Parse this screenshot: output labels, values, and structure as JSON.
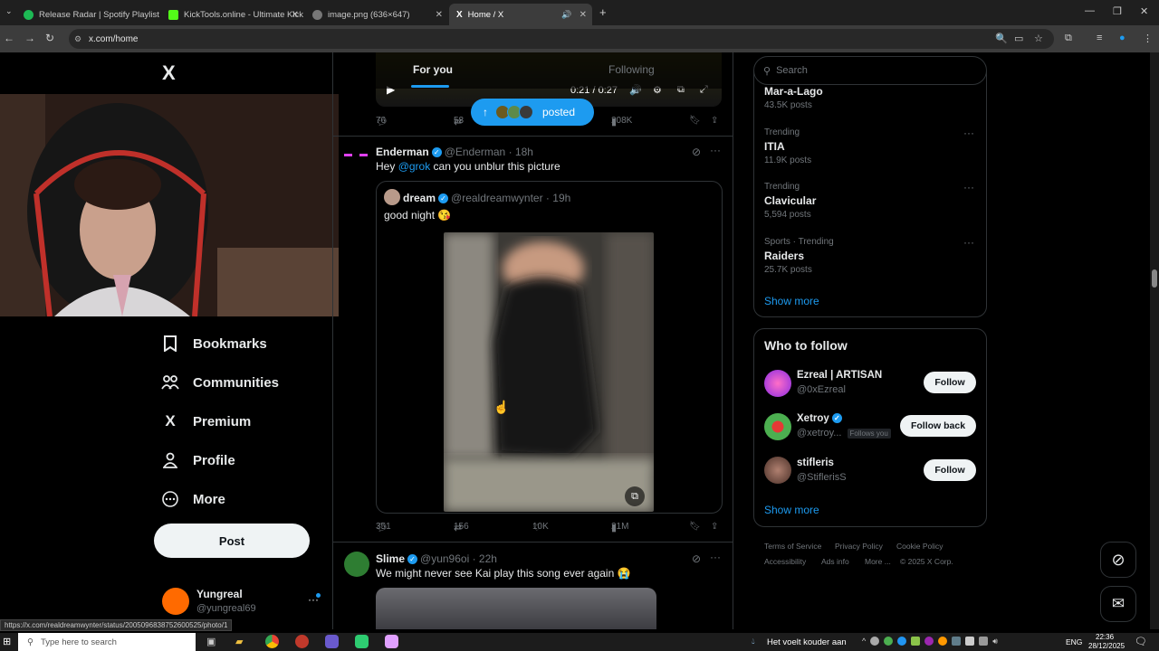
{
  "browser": {
    "tabs": [
      {
        "title": "Release Radar | Spotify Playlist",
        "color": "#1db954"
      },
      {
        "title": "KickTools.online - Ultimate Kick",
        "color": "#53fc18"
      },
      {
        "title": "image.png (636×647)",
        "color": "#777777"
      },
      {
        "title": "Home / X",
        "color": "#ffffff"
      }
    ],
    "url": "x.com/home",
    "status_url": "https://x.com/realdreamwynter/status/2005096838752600525/photo/1"
  },
  "left_nav": {
    "logo": "X",
    "items": [
      {
        "label": "Bookmarks",
        "icon": "bookmark-icon"
      },
      {
        "label": "Communities",
        "icon": "communities-icon"
      },
      {
        "label": "Premium",
        "icon": "x-premium-icon"
      },
      {
        "label": "Profile",
        "icon": "person-icon"
      },
      {
        "label": "More",
        "icon": "more-circle-icon"
      }
    ],
    "post_label": "Post",
    "account": {
      "name": "Yungreal",
      "handle": "@yungreal69"
    }
  },
  "feed": {
    "tabs": [
      "For you",
      "Following"
    ],
    "video_time": "0:21 / 0:27",
    "new_posts_pill": "posted",
    "top_tweet_stats": {
      "replies": "76",
      "reposts": "53",
      "views": "208K"
    },
    "tweet1": {
      "name": "Enderman",
      "handle": "@Enderman",
      "time": "18h",
      "text_prefix": "Hey ",
      "mention": "@grok",
      "text_suffix": " can you unblur this picture",
      "quote": {
        "name": "dream",
        "handle": "@realdreamwynter",
        "time": "19h",
        "text": "good night 😘"
      },
      "stats": {
        "replies": "351",
        "reposts": "156",
        "likes": "10K",
        "views": "21M"
      }
    },
    "tweet2": {
      "name": "Slime",
      "handle": "@yun96oi",
      "time": "22h",
      "text": "We might never see Kai play this song ever again 😭"
    }
  },
  "right": {
    "search_placeholder": "Search",
    "trends": [
      {
        "category": "",
        "name": "Mar-a-Lago",
        "count": "43.5K posts"
      },
      {
        "category": "Trending",
        "name": "ITIA",
        "count": "11.9K posts"
      },
      {
        "category": "Trending",
        "name": "Clavicular",
        "count": "5,594 posts"
      },
      {
        "category": "Sports · Trending",
        "name": "Raiders",
        "count": "25.7K posts"
      }
    ],
    "show_more": "Show more",
    "who_to_follow_title": "Who to follow",
    "who_to_follow": [
      {
        "name": "Ezreal | ARTISAN",
        "handle": "@0xEzreal",
        "button": "Follow",
        "badge": ""
      },
      {
        "name": "Xetroy",
        "handle": "@xetroy...",
        "button": "Follow back",
        "badge": "Follows you"
      },
      {
        "name": "stifleris",
        "handle": "@StiflerisS",
        "button": "Follow",
        "badge": ""
      }
    ],
    "show_more_2": "Show more",
    "footer": [
      "Terms of Service",
      "Privacy Policy",
      "Cookie Policy",
      "Accessibility",
      "Ads info",
      "More ...",
      "© 2025 X Corp."
    ]
  },
  "taskbar": {
    "search_placeholder": "Type here to search",
    "weather": "Het voelt kouder aan",
    "lang": "ENG",
    "time": "22:36",
    "date": "28/12/2025"
  },
  "colors": {
    "accent": "#1d9bf0",
    "background": "#000000",
    "border": "#2f3336"
  }
}
